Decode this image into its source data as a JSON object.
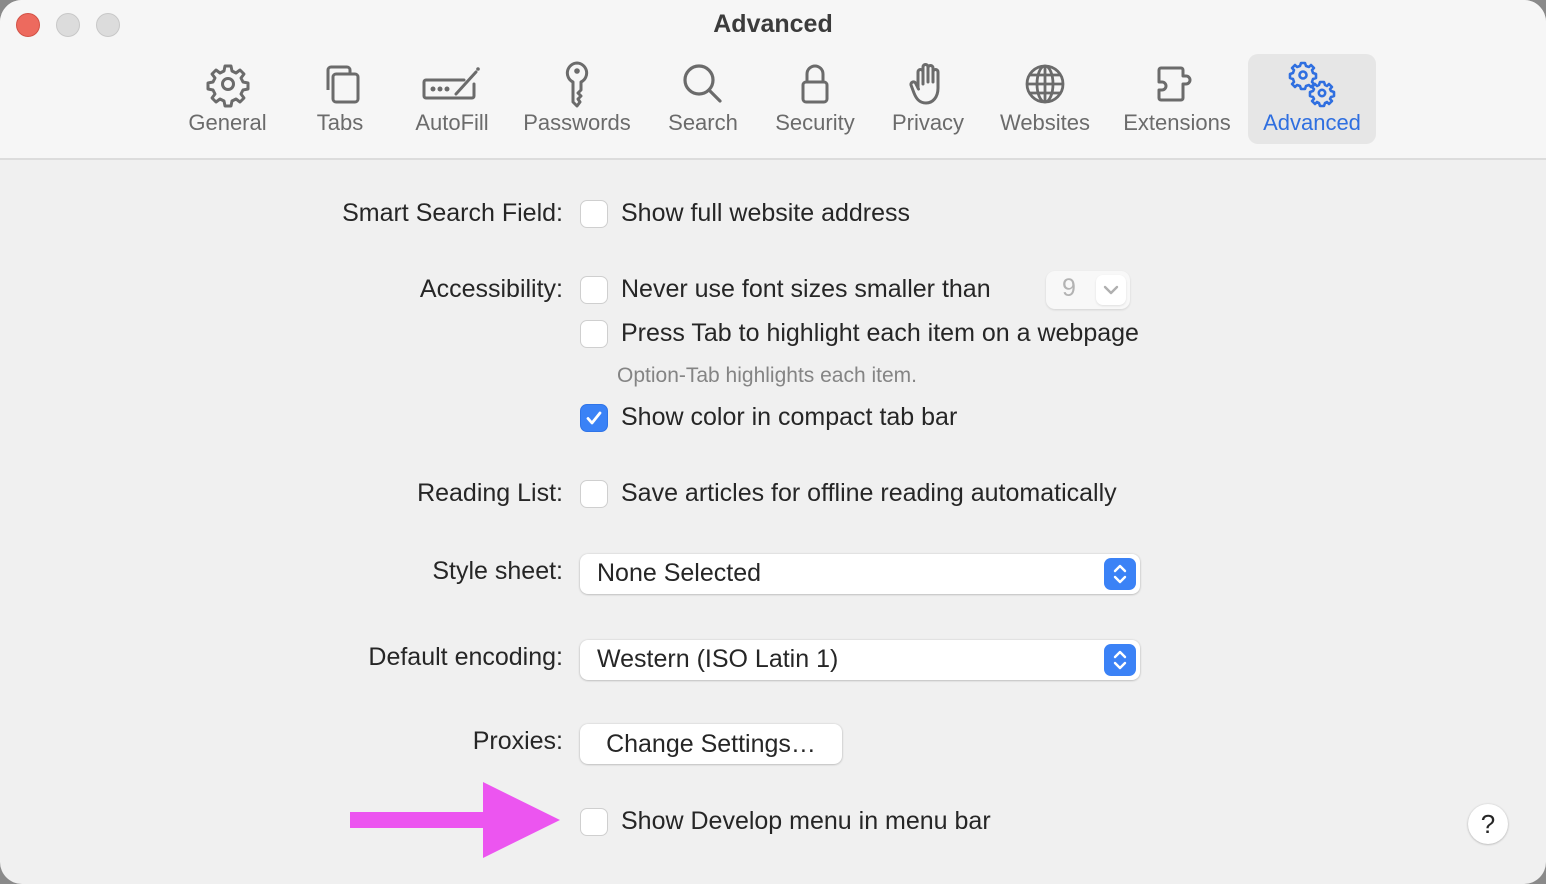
{
  "window": {
    "title": "Advanced",
    "traffic_lights": [
      "close",
      "minimize",
      "zoom"
    ]
  },
  "toolbar": {
    "items": [
      {
        "label": "General",
        "icon": "gear-icon",
        "active": false
      },
      {
        "label": "Tabs",
        "icon": "tabs-icon",
        "active": false
      },
      {
        "label": "AutoFill",
        "icon": "autofill-icon",
        "active": false
      },
      {
        "label": "Passwords",
        "icon": "key-icon",
        "active": false
      },
      {
        "label": "Search",
        "icon": "magnifier-icon",
        "active": false
      },
      {
        "label": "Security",
        "icon": "lock-icon",
        "active": false
      },
      {
        "label": "Privacy",
        "icon": "hand-icon",
        "active": false
      },
      {
        "label": "Websites",
        "icon": "globe-icon",
        "active": false
      },
      {
        "label": "Extensions",
        "icon": "puzzle-icon",
        "active": false
      },
      {
        "label": "Advanced",
        "icon": "gears-icon",
        "active": true
      }
    ]
  },
  "settings": {
    "smart_search": {
      "label": "Smart Search Field:",
      "option": {
        "text": "Show full website address",
        "checked": false
      }
    },
    "accessibility": {
      "label": "Accessibility:",
      "options": [
        {
          "text": "Never use font sizes smaller than",
          "checked": false
        },
        {
          "text": "Press Tab to highlight each item on a webpage",
          "checked": false
        },
        {
          "text": "Show color in compact tab bar",
          "checked": true
        }
      ],
      "font_size_value": "9",
      "hint": "Option-Tab highlights each item."
    },
    "reading_list": {
      "label": "Reading List:",
      "option": {
        "text": "Save articles for offline reading automatically",
        "checked": false
      }
    },
    "style_sheet": {
      "label": "Style sheet:",
      "value": "None Selected"
    },
    "default_encoding": {
      "label": "Default encoding:",
      "value": "Western (ISO Latin 1)"
    },
    "proxies": {
      "label": "Proxies:",
      "button": "Change Settings…"
    },
    "develop_menu": {
      "option": {
        "text": "Show Develop menu in menu bar",
        "checked": false
      }
    },
    "help_label": "?"
  },
  "annotation": {
    "arrow_color": "#ec55f0",
    "points_to": "Show Develop menu in menu bar"
  },
  "colors": {
    "accent": "#3a82f6",
    "active_tab_text": "#2f6fe0",
    "close_button": "#ed6a5e"
  }
}
